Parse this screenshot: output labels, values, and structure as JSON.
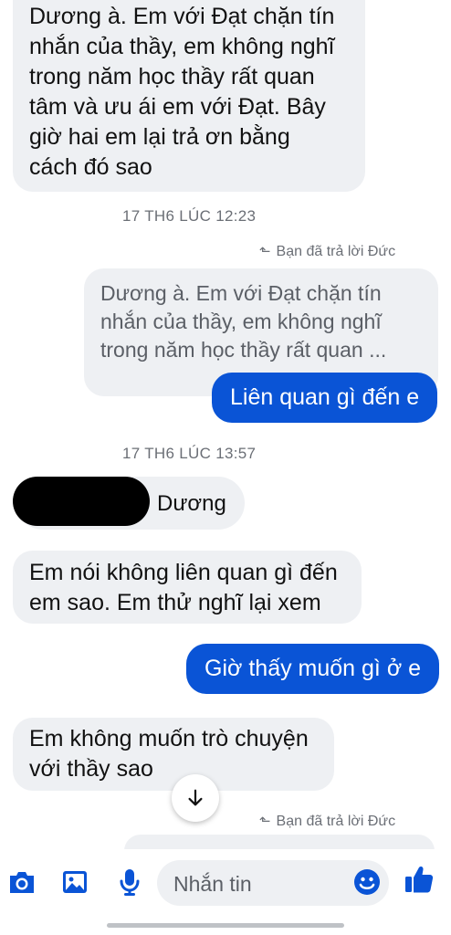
{
  "colors": {
    "accent": "#0a54d6",
    "incoming_bg": "#eef0f3",
    "meta_text": "#6b6f76"
  },
  "messages": {
    "m1_lines": [
      "Dương à. Em với Đạt chặn tín",
      "nhắn của thầy, em không nghĩ",
      "trong năm học thầy rất quan",
      "tâm và ưu ái em với Đạt. Bây",
      "giờ hai em lại trả ơn bằng",
      "cách đó sao"
    ],
    "timestamp1": "17 TH6 LÚC 12:23",
    "reply_note1": "Bạn đã trả lời Đức",
    "quoted_lines": [
      "Dương à. Em với Đạt chặn tín",
      "nhắn của thầy, em không nghĩ",
      "trong năm học thầy rất quan ..."
    ],
    "out1": "Liên quan gì đến e",
    "timestamp2": "17 TH6 LÚC 13:57",
    "sender_name": "Dương",
    "m2_lines": [
      "Em nói không liên quan gì đến",
      "em sao. Em thử nghĩ lại xem"
    ],
    "out2": "Giờ thấy muốn gì ở e",
    "m3_lines": [
      "Em không muốn trò chuyện",
      "với thầy sao"
    ],
    "reply_note2": "Bạn đã trả lời Đức"
  },
  "composer": {
    "placeholder": "Nhắn tin",
    "icons": [
      "camera-icon",
      "image-icon",
      "microphone-icon",
      "emoji-icon",
      "thumbs-up-icon"
    ]
  },
  "scroll_icon": "arrow-down-icon"
}
